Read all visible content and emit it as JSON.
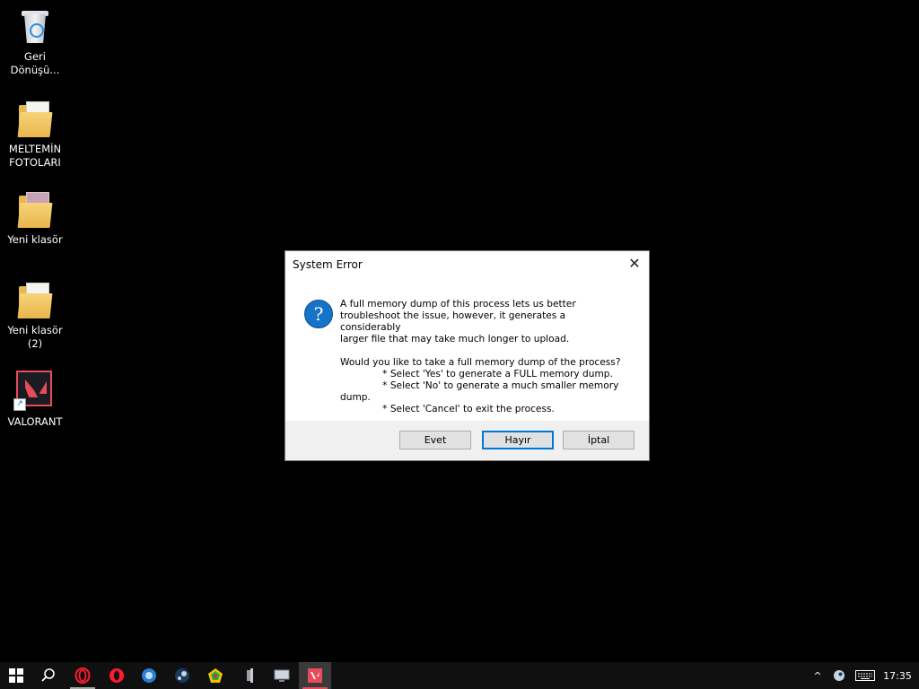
{
  "desktop": {
    "icons": [
      {
        "label": "Geri\nDönüşü..."
      },
      {
        "label": "MELTEMİN\nFOTOLARI"
      },
      {
        "label": "Yeni klasör"
      },
      {
        "label": "Yeni klasör (2)"
      },
      {
        "label": "VALORANT"
      }
    ]
  },
  "dialog": {
    "title": "System Error",
    "close_glyph": "✕",
    "icon_glyph": "?",
    "message": "A full memory dump of this process lets us better\ntroubleshoot the issue, however, it generates a considerably\nlarger file that may take much longer to upload.\n\nWould you like to take a full memory dump of the process?\n              * Select 'Yes' to generate a FULL memory dump.\n              * Select 'No' to generate a much smaller memory\ndump.\n              * Select 'Cancel' to exit the process.",
    "buttons": {
      "yes": "Evet",
      "no": "Hayır",
      "cancel": "İptal"
    }
  },
  "taskbar": {
    "clock": "17:35",
    "tray_chevron": "^",
    "colors": {
      "opera": "#ff1b2d",
      "steam": "#c7d5e0",
      "valorant": "#e84b5a",
      "accent": "#0078d7"
    }
  }
}
